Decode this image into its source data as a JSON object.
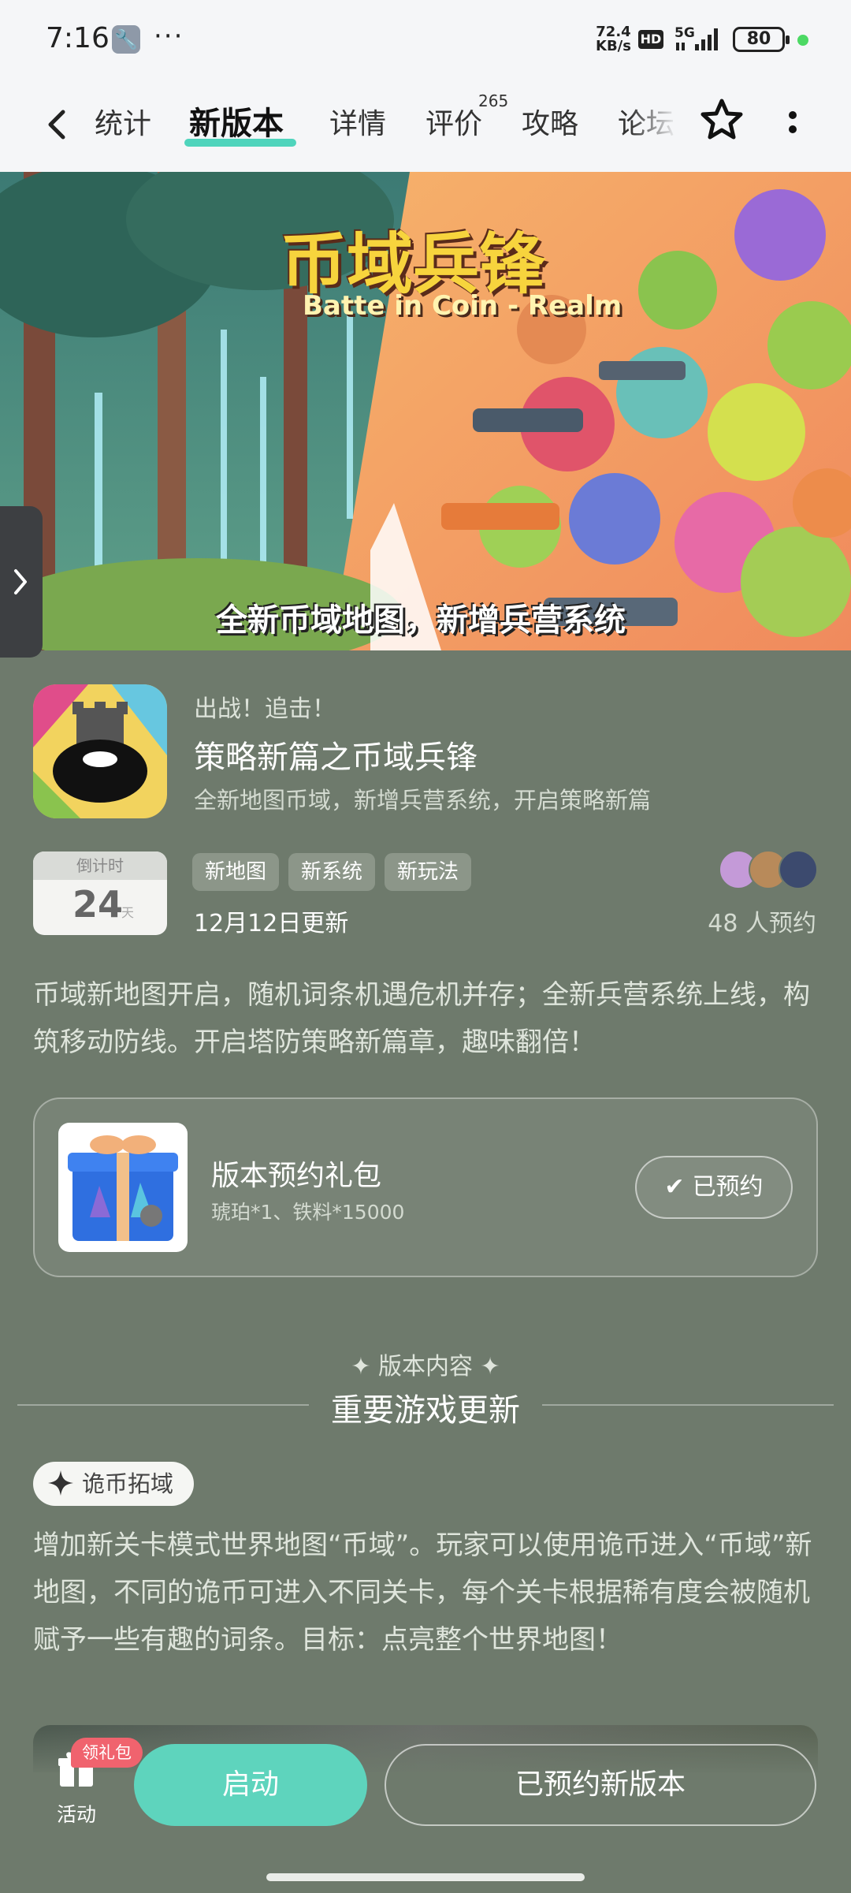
{
  "status_bar": {
    "time": "7:16",
    "net_speed_value": "72.4",
    "net_speed_unit": "KB/s",
    "hd": "HD",
    "network": "5G",
    "battery": "80"
  },
  "nav": {
    "tabs": [
      {
        "label": "统计"
      },
      {
        "label": "新版本"
      },
      {
        "label": "详情"
      },
      {
        "label": "评价",
        "badge": "265"
      },
      {
        "label": "攻略"
      },
      {
        "label": "论坛"
      }
    ]
  },
  "banner": {
    "title": "币域兵锋",
    "subtitle": "Batte in Coin - Realm",
    "caption": "全新币域地图，新增兵营系统"
  },
  "version": {
    "sub_title": "出战！追击！",
    "title": "策略新篇之币域兵锋",
    "description": "全新地图币域，新增兵营系统，开启策略新篇",
    "countdown_label": "倒计时",
    "countdown_value": "24",
    "countdown_unit": "天",
    "tags": [
      "新地图",
      "新系统",
      "新玩法"
    ],
    "update_date": "12月12日更新",
    "reserve_count": "48 人预约",
    "intro": "币域新地图开启，随机词条机遇危机并存；全新兵营系统上线，构筑移动防线。开启塔防策略新篇章，趣味翻倍！"
  },
  "gift": {
    "title": "版本预约礼包",
    "description": "琥珀*1、铁料*15000",
    "button_label": "已预约"
  },
  "content": {
    "kicker": "版本内容",
    "title": "重要游戏更新",
    "feature_chip": "诡币拓域",
    "feature_text": "增加新关卡模式世界地图“币域”。玩家可以使用诡币进入“币域”新地图，不同的诡币可进入不同关卡，每个关卡根据稀有度会被随机赋予一些有趣的词条。目标：点亮整个世界地图！"
  },
  "bottom": {
    "activity_label": "活动",
    "gift_badge": "领礼包",
    "launch_label": "启动",
    "reserved_version_label": "已预约新版本"
  },
  "colors": {
    "accent": "#5ed4bd",
    "background": "#6e7a6c",
    "badge": "#f0636e"
  },
  "icons": [
    "back-icon",
    "star-icon",
    "more-icon",
    "chevron-right-icon",
    "check-icon",
    "sparkle-icon",
    "gift-box-icon",
    "wrench-icon"
  ]
}
